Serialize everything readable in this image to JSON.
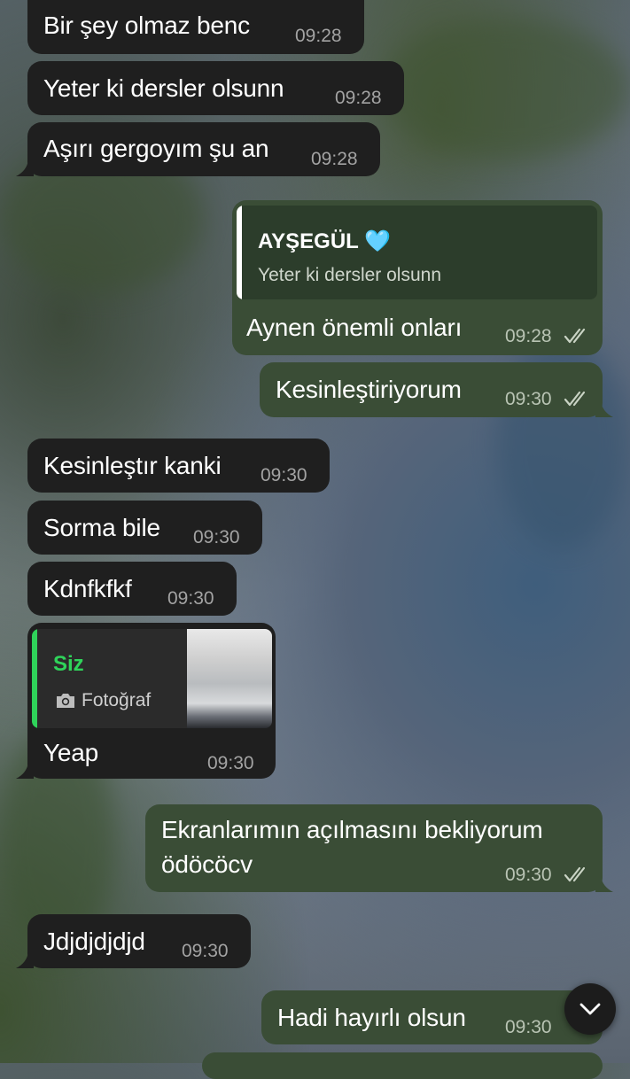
{
  "messages": [
    {
      "text": "Bir şey olmaz benc",
      "time": "09:28",
      "dir": "in"
    },
    {
      "text": "Yeter ki dersler olsunn",
      "time": "09:28",
      "dir": "in"
    },
    {
      "text": "Aşırı gergoyım şu an",
      "time": "09:28",
      "dir": "in"
    },
    {
      "text": "Aynen önemli onları",
      "time": "09:28",
      "dir": "out",
      "reply": {
        "name": "AYŞEGÜL 🩵",
        "text": "Yeter ki dersler olsunn"
      }
    },
    {
      "text": "Kesinleştiriyorum",
      "time": "09:30",
      "dir": "out"
    },
    {
      "text": "Kesinleştır kanki",
      "time": "09:30",
      "dir": "in"
    },
    {
      "text": "Sorma bile",
      "time": "09:30",
      "dir": "in"
    },
    {
      "text": "Kdnfkfkf",
      "time": "09:30",
      "dir": "in"
    },
    {
      "text": "Yeap",
      "time": "09:30",
      "dir": "in",
      "reply": {
        "name": "Siz",
        "text": "Fotoğraf"
      }
    },
    {
      "text_line1": "Ekranlarımın açılmasını bekliyorum",
      "text_line2": "ödöcöcv",
      "time": "09:30",
      "dir": "out"
    },
    {
      "text": "Jdjdjdjdjd",
      "time": "09:30",
      "dir": "in"
    },
    {
      "text": "Hadi hayırlı olsun",
      "time": "09:30",
      "dir": "out"
    }
  ],
  "icons": {
    "read_receipt": "double-check-icon",
    "scroll_down": "chevron-down-icon",
    "photo": "camera-icon"
  },
  "colors": {
    "incoming_bubble": "#1f1f1f",
    "outgoing_bubble": "#3a4d36",
    "reply_accent_green": "#2fd35a"
  }
}
